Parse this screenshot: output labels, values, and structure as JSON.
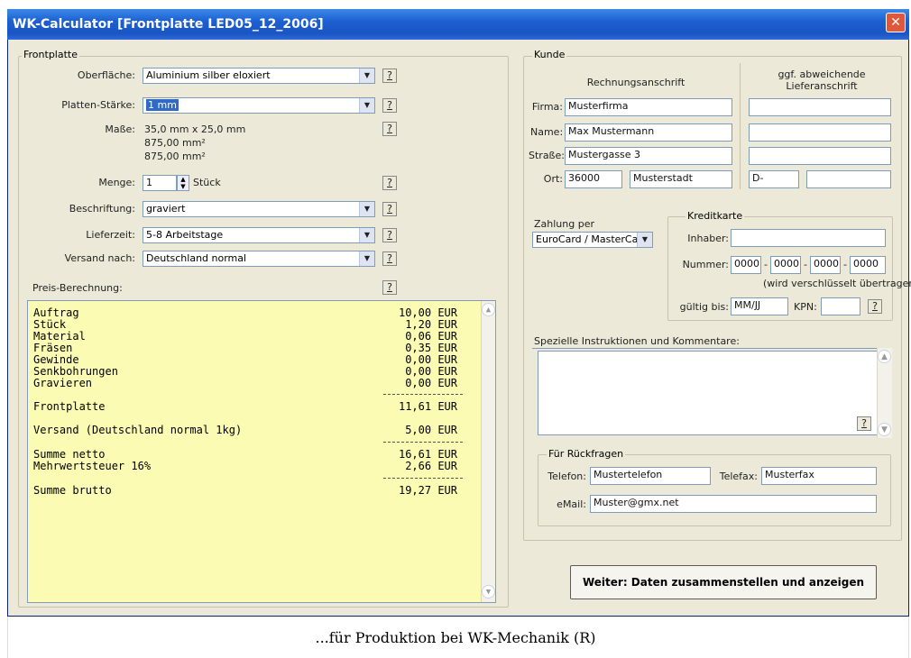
{
  "window": {
    "title": "WK-Calculator  [Frontplatte  LED05_12_2006]",
    "close": "✕"
  },
  "frontplatte": {
    "group_label": "Frontplatte",
    "help": "?",
    "oberflaeche": {
      "label": "Oberfläche:",
      "value": "Aluminium silber eloxiert"
    },
    "platten_staerke": {
      "label": "Platten-Stärke:",
      "value": "1 mm"
    },
    "masse": {
      "label": "Maße:",
      "line1": "35,0 mm x 25,0 mm",
      "line2": "875,00 mm²",
      "line3": "875,00 mm²"
    },
    "menge": {
      "label": "Menge:",
      "value": "1",
      "unit": "Stück"
    },
    "beschriftung": {
      "label": "Beschriftung:",
      "value": "graviert"
    },
    "lieferzeit": {
      "label": "Lieferzeit:",
      "value": "5-8 Arbeitstage"
    },
    "versand_nach": {
      "label": "Versand nach:",
      "value": "Deutschland normal"
    },
    "preis_label": "Preis-Berechnung:"
  },
  "preis": {
    "rows": [
      {
        "name": "Auftrag",
        "value": "10,00 EUR"
      },
      {
        "name": "Stück",
        "value": "1,20 EUR"
      },
      {
        "name": "Material",
        "value": "0,06 EUR"
      },
      {
        "name": "Fräsen",
        "value": "0,35 EUR"
      },
      {
        "name": "Gewinde",
        "value": "0,00 EUR"
      },
      {
        "name": "Senkbohrungen",
        "value": "0,00 EUR"
      },
      {
        "name": "Gravieren",
        "value": "0,00 EUR"
      },
      {
        "name": "Frontplatte",
        "value": "11,61 EUR"
      },
      {
        "name": "Versand (Deutschland normal 1kg)",
        "value": "5,00 EUR"
      },
      {
        "name": "Summe netto",
        "value": "16,61 EUR"
      },
      {
        "name": "Mehrwertsteuer 16%",
        "value": "2,66 EUR"
      },
      {
        "name": "Summe brutto",
        "value": "19,27 EUR"
      }
    ]
  },
  "kunde": {
    "group_label": "Kunde",
    "rechnungsanschrift": "Rechnungsanschrift",
    "abweichend": "ggf. abweichende Lieferanschrift",
    "firma": {
      "label": "Firma:",
      "value": "Musterfirma",
      "alt": ""
    },
    "name": {
      "label": "Name:",
      "value": "Max Mustermann",
      "alt": ""
    },
    "strasse": {
      "label": "Straße:",
      "value": "Mustergasse 3",
      "alt": ""
    },
    "ort": {
      "label": "Ort:",
      "plz": "36000",
      "city": "Musterstadt",
      "alt_plz": "D-",
      "alt_city": ""
    }
  },
  "zahlung": {
    "label": "Zahlung per",
    "value": "EuroCard / MasterCard",
    "kreditkarte": "Kreditkarte",
    "inhaber": {
      "label": "Inhaber:",
      "value": ""
    },
    "nummer": {
      "label": "Nummer:",
      "parts": [
        "0000",
        "0000",
        "0000",
        "0000"
      ],
      "dash": "-"
    },
    "verschluesselt": "(wird verschlüsselt übertragen)",
    "gueltig": {
      "label": "gültig bis:",
      "value": "MM/JJ"
    },
    "kpn": {
      "label": "KPN:",
      "value": ""
    },
    "help": "?"
  },
  "instruktionen": {
    "label": "Spezielle Instruktionen und Kommentare:",
    "help": "?",
    "value": ""
  },
  "rueckfragen": {
    "group_label": "Für Rückfragen",
    "telefon": {
      "label": "Telefon:",
      "value": "Mustertelefon"
    },
    "telefax": {
      "label": "Telefax:",
      "value": "Musterfax"
    },
    "email": {
      "label": "eMail:",
      "value": "Muster@gmx.net"
    }
  },
  "weiter_button": "Weiter: Daten zusammenstellen und anzeigen",
  "caption": "...für Produktion bei WK-Mechanik (R)",
  "colors": {
    "title_bar": "#1c5fd1",
    "output_bg": "#fbfbb4",
    "dialog_bg": "#ece9d8"
  }
}
